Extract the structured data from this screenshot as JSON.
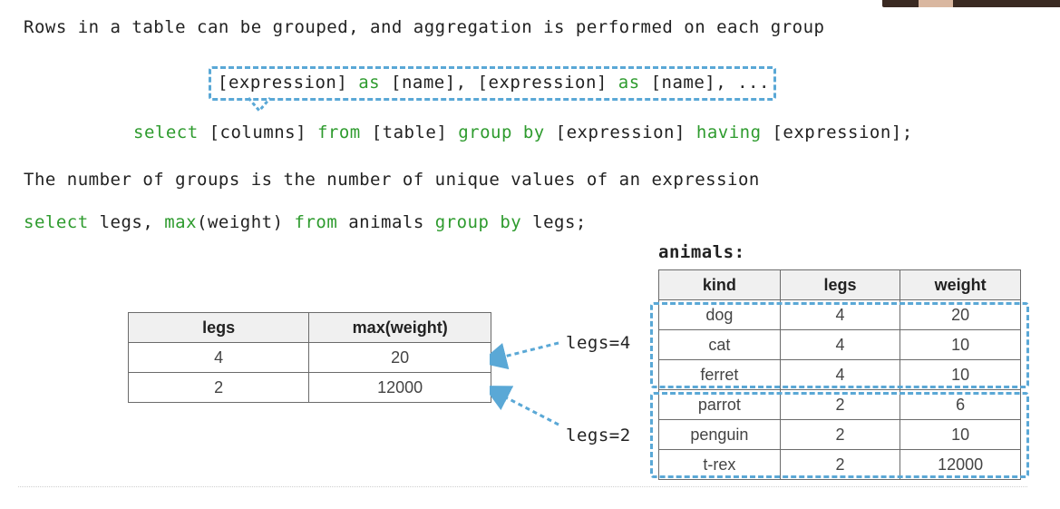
{
  "intro": "Rows in a table can be grouped, and aggregation is performed on each group",
  "cols_expr": {
    "t1": "[expression] ",
    "k1": "as",
    "t2": " [name], [expression] ",
    "k2": "as",
    "t3": " [name], ..."
  },
  "select_syntax": {
    "k1": "select",
    "t1": " [columns] ",
    "k2": "from",
    "t2": " [table] ",
    "k3": "group by",
    "t3": " [expression] ",
    "k4": "having",
    "t4": " [expression];"
  },
  "groups_note": "The number of groups is the number of unique values of an expression",
  "example": {
    "k1": "select",
    "t1": " legs, ",
    "k2": "max",
    "t2": "(weight) ",
    "k3": "from",
    "t3": " animals ",
    "k4": "group by",
    "t4": " legs;"
  },
  "animals_title": "animals:",
  "animals_table": {
    "headers": [
      "kind",
      "legs",
      "weight"
    ],
    "rows": [
      [
        "dog",
        "4",
        "20"
      ],
      [
        "cat",
        "4",
        "10"
      ],
      [
        "ferret",
        "4",
        "10"
      ],
      [
        "parrot",
        "2",
        "6"
      ],
      [
        "penguin",
        "2",
        "10"
      ],
      [
        "t-rex",
        "2",
        "12000"
      ]
    ]
  },
  "result_table": {
    "headers": [
      "legs",
      "max(weight)"
    ],
    "rows": [
      [
        "4",
        "20"
      ],
      [
        "2",
        "12000"
      ]
    ]
  },
  "labels": {
    "group4": "legs=4",
    "group2": "legs=2"
  },
  "colors": {
    "keyword": "#2e9b2e",
    "dashed": "#5aa8d6"
  }
}
